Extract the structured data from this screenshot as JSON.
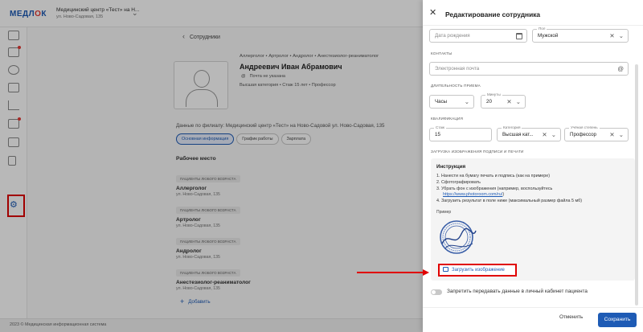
{
  "app": {
    "logo": "МЕДЛОК",
    "clinic_name": "Медицинский центр «Тест» на Н...",
    "clinic_address": "ул. Ново-Садовая, 135"
  },
  "colors": {
    "accent": "#1e5bb5",
    "highlight": "#e00000"
  },
  "sidebar": {
    "icons": [
      "calendar-icon",
      "checklist-icon",
      "people-icon",
      "document-icon",
      "chart-icon",
      "report-icon",
      "box-icon",
      "finance-icon",
      "settings-icon"
    ]
  },
  "page": {
    "back_label": "Сотрудники",
    "specialties": "Аллерголог • Артролог • Андролог • Анестезиолог-реаниматолог",
    "employee_name": "Андреевич Иван Абрамович",
    "no_email": "Почта не указана",
    "meta": "Высшая категория • Стаж 15 лет • Профессор",
    "branch_text": "Данные по филиалу: Медицинский центр «Тест» на Ново-Садовой ул. Ново-Садовая, 135",
    "tabs": [
      "Основная информация",
      "График работы",
      "Зарплата"
    ],
    "workplace_title": "Рабочее место",
    "workplaces": [
      {
        "badge": "ПАЦИЕНТЫ ЛЮБОГО ВОЗРАСТА",
        "spec": "Аллерголог",
        "address": "ул. Ново-Садовая, 135"
      },
      {
        "badge": "ПАЦИЕНТЫ ЛЮБОГО ВОЗРАСТА",
        "spec": "Артролог",
        "address": "ул. Ново-Садовая, 135"
      },
      {
        "badge": "ПАЦИЕНТЫ ЛЮБОГО ВОЗРАСТА",
        "spec": "Андролог",
        "address": "ул. Ново-Садовая, 135"
      },
      {
        "badge": "ПАЦИЕНТЫ ЛЮБОГО ВОЗРАСТА",
        "spec": "Анестезиолог-реаниматолог",
        "address": "ул. Ново-Садовая, 135"
      }
    ],
    "add_label": "Добавить"
  },
  "footer": {
    "text": "2023 ©  Медицинская информационная система"
  },
  "drawer": {
    "title": "Редактирование сотрудника",
    "birth_placeholder": "Дата рождения",
    "gender_label": "Пол",
    "gender_value": "Мужской",
    "contacts_label": "КОНТАКТЫ",
    "email_placeholder": "Электронная почта",
    "duration_label": "ДЛИТЕЛЬНОСТЬ ПРИЕМА",
    "hours_value": "Часы",
    "minutes_label": "Минуты",
    "minutes_value": "20",
    "qualification_label": "КВАЛИФИКАЦИЯ",
    "experience_label": "Стаж",
    "experience_value": "15",
    "category_label": "Категория",
    "category_value": "Высшая кат...",
    "degree_label": "Учёная степень",
    "degree_value": "Профессор",
    "signature_label": "ЗАГРУЗКА ИЗОБРАЖЕНИЯ ПОДПИСИ И ПЕЧАТИ",
    "instruction_title": "Инструкция",
    "steps": [
      "1. Нанести на бумагу печать и подпись (как на примере)",
      "2. Сфотографировать",
      "3. Убрать фон с изображения (например, воспользуйтесь",
      "4. Загрузить результат в поле ниже (максимальный размер файла 5 мб)"
    ],
    "link": "https://www.photoroom.com/ru/",
    "link_suffix": ")",
    "example_label": "Пример",
    "upload_label": "Загрузить изображение",
    "toggle_label": "Запретить передавать данные в личный кабинет пациента",
    "cancel_label": "Отменить",
    "save_label": "Сохранить"
  }
}
